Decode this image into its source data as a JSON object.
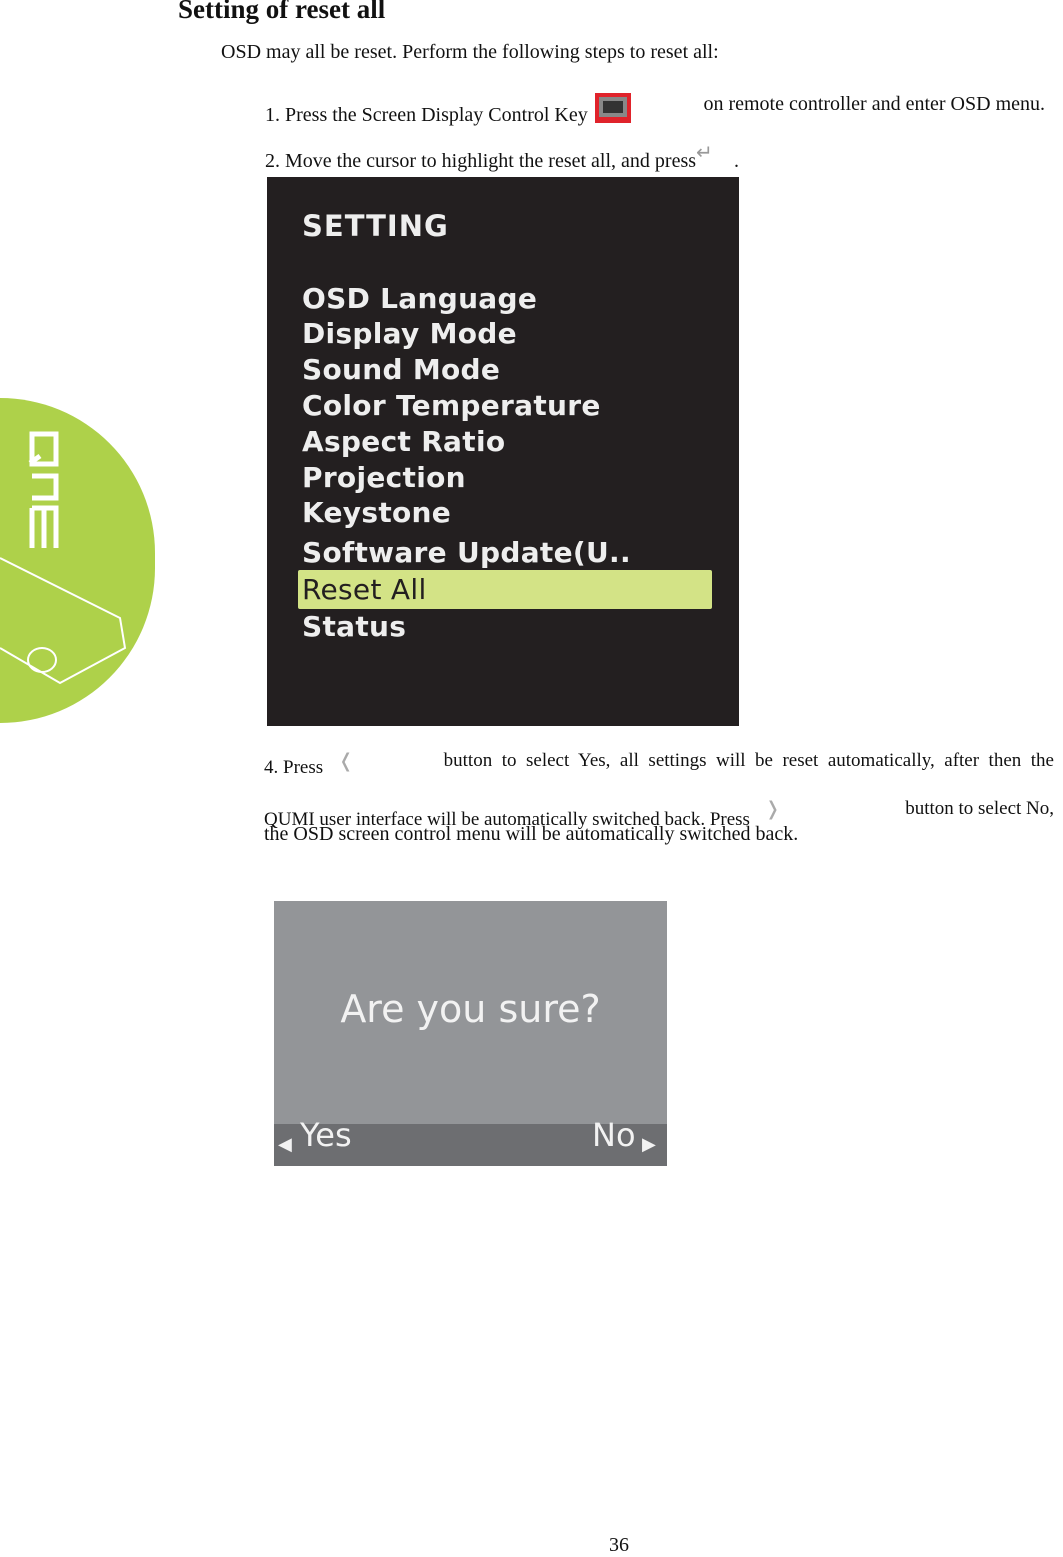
{
  "title": "Setting of reset all",
  "intro": "OSD may all be reset. Perform the following steps to reset all:",
  "step1_a": "1. Press the Screen Display Control Key",
  "step1_b": "on remote controller and enter OSD menu.",
  "step2_a": "2. Move the cursor to highlight the reset all, and press",
  "step2_b": ".",
  "osd": {
    "title": "SETTING",
    "items": [
      "OSD Language",
      "Display Mode",
      "Sound Mode",
      "Color Temperature",
      "Aspect Ratio",
      "Projection",
      "Keystone",
      "Software Update(U..",
      "Reset All",
      "Status"
    ],
    "selected": "Reset All",
    "highlight_color": "#d3e386"
  },
  "step4_l1_a": "4.  Press",
  "step4_l1_b": "button  to  select  Yes,  all  settings  will  be  reset  automatically,  after  then  the",
  "step4_l2_a": "QUMI user interface will be automatically switched back. Press",
  "step4_l2_b": "button to select No,",
  "step4_l3": "the OSD screen control menu will be automatically switched back.",
  "dialog": {
    "question": "Are you sure?",
    "yes": "Yes",
    "no": "No"
  },
  "logo": {
    "text": "QUMI",
    "color": "#aed14a"
  },
  "page_number": "36"
}
